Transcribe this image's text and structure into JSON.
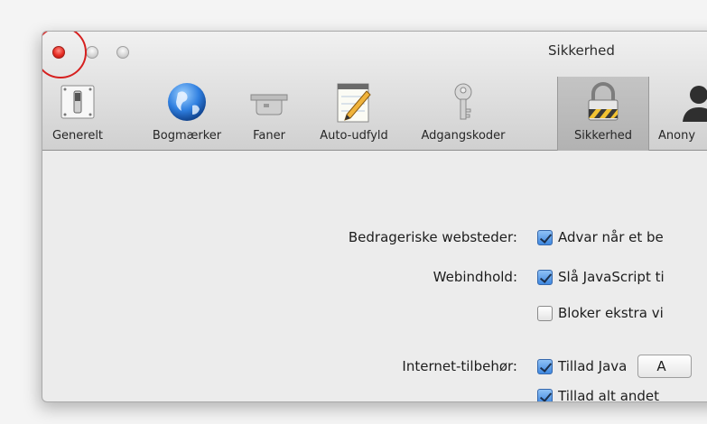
{
  "window": {
    "title": "Sikkerhed"
  },
  "toolbar": {
    "items": [
      {
        "label": "Generelt",
        "icon": "switch-icon"
      },
      {
        "label": "Bogmærker",
        "icon": "globe-icon"
      },
      {
        "label": "Faner",
        "icon": "tabs-icon"
      },
      {
        "label": "Auto-udfyld",
        "icon": "pencil-notepad-icon"
      },
      {
        "label": "Adgangskoder",
        "icon": "key-icon"
      },
      {
        "label": "Sikkerhed",
        "icon": "padlock-icon",
        "selected": true
      },
      {
        "label": "Anony",
        "icon": "silhouette-icon"
      }
    ]
  },
  "settings": {
    "fraud": {
      "label": "Bedrageriske websteder:",
      "option": "Advar når et be",
      "checked": true
    },
    "web_content": {
      "label": "Webindhold:",
      "options": [
        {
          "text": "Slå JavaScript ti",
          "checked": true
        },
        {
          "text": "Bloker ekstra vi",
          "checked": false
        }
      ]
    },
    "plugins": {
      "label": "Internet-tilbehør:",
      "java": {
        "text": "Tillad Java",
        "checked": true,
        "dropdown_value": "A"
      },
      "other": {
        "text": "Tillad alt andet",
        "checked": true
      }
    }
  },
  "colors": {
    "close_button": "#e62d24",
    "highlight_ring": "#d6201f",
    "checkbox_blue": "#3f88e0"
  }
}
